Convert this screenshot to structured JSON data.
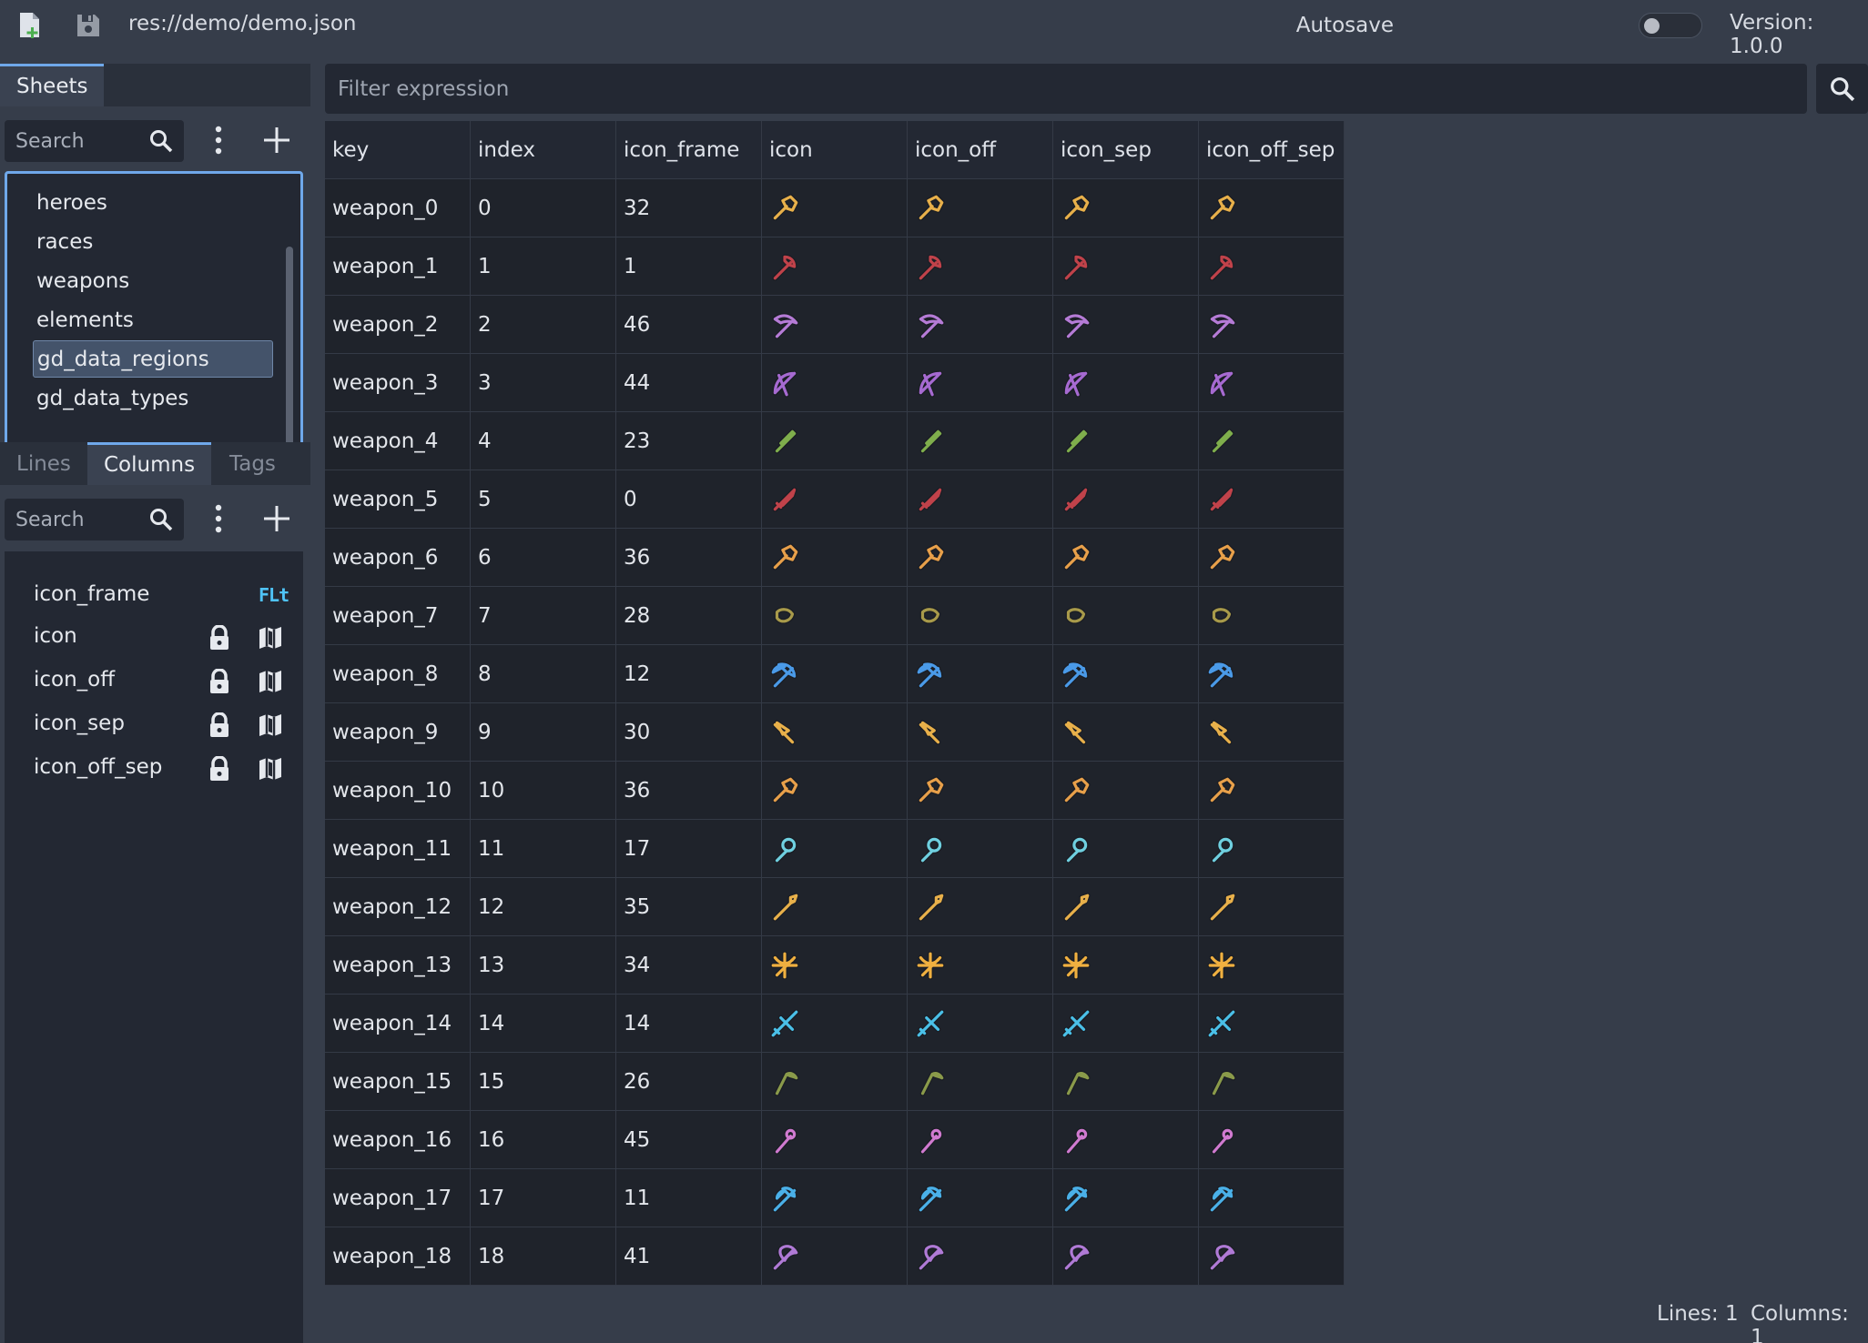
{
  "toolbar": {
    "file_path": "res://demo/demo.json",
    "autosave_label": "Autosave",
    "autosave_on": false,
    "version": "Version: 1.0.0"
  },
  "sheets_panel": {
    "tab_label": "Sheets",
    "search_placeholder": "Search",
    "items": [
      "heroes",
      "races",
      "weapons",
      "elements",
      "gd_data_regions",
      "gd_data_types"
    ],
    "selected": "gd_data_regions"
  },
  "columns_panel": {
    "tabs": [
      "Lines",
      "Columns",
      "Tags"
    ],
    "active_tab": "Columns",
    "search_placeholder": "Search",
    "items": [
      {
        "name": "icon_frame",
        "badge": "FLt"
      },
      {
        "name": "icon",
        "locked": true
      },
      {
        "name": "icon_off",
        "locked": true
      },
      {
        "name": "icon_sep",
        "locked": true
      },
      {
        "name": "icon_off_sep",
        "locked": true
      }
    ]
  },
  "filter": {
    "placeholder": "Filter expression"
  },
  "table": {
    "headers": [
      "key",
      "index",
      "icon_frame",
      "icon",
      "icon_off",
      "icon_sep",
      "icon_off_sep"
    ],
    "rows": [
      {
        "key": "weapon_0",
        "index": "0",
        "icon_frame": "32",
        "icon": "hammer-icon",
        "color": "#e8b04a"
      },
      {
        "key": "weapon_1",
        "index": "1",
        "icon_frame": "1",
        "icon": "axe-icon",
        "color": "#c0424a"
      },
      {
        "key": "weapon_2",
        "index": "2",
        "icon_frame": "46",
        "icon": "pickaxe-icon",
        "color": "#b57bd6"
      },
      {
        "key": "weapon_3",
        "index": "3",
        "icon_frame": "44",
        "icon": "bow-icon",
        "color": "#a66ad1"
      },
      {
        "key": "weapon_4",
        "index": "4",
        "icon_frame": "23",
        "icon": "dagger-icon",
        "color": "#7fae4c"
      },
      {
        "key": "weapon_5",
        "index": "5",
        "icon_frame": "0",
        "icon": "sword-icon",
        "color": "#c0424a"
      },
      {
        "key": "weapon_6",
        "index": "6",
        "icon_frame": "36",
        "icon": "hammer-icon",
        "color": "#e8a04a"
      },
      {
        "key": "weapon_7",
        "index": "7",
        "icon_frame": "28",
        "icon": "sling-icon",
        "color": "#a89a4a"
      },
      {
        "key": "weapon_8",
        "index": "8",
        "icon_frame": "12",
        "icon": "battleaxe-icon",
        "color": "#4a9ae8"
      },
      {
        "key": "weapon_9",
        "index": "9",
        "icon_frame": "30",
        "icon": "knife-icon",
        "color": "#e8b04a"
      },
      {
        "key": "weapon_10",
        "index": "10",
        "icon_frame": "36",
        "icon": "hammer-icon",
        "color": "#e8a04a"
      },
      {
        "key": "weapon_11",
        "index": "11",
        "icon_frame": "17",
        "icon": "mace-icon",
        "color": "#6fd0e0"
      },
      {
        "key": "weapon_12",
        "index": "12",
        "icon_frame": "35",
        "icon": "spear-icon",
        "color": "#e8b04a"
      },
      {
        "key": "weapon_13",
        "index": "13",
        "icon_frame": "34",
        "icon": "crossbow-icon",
        "color": "#f0b040"
      },
      {
        "key": "weapon_14",
        "index": "14",
        "icon_frame": "14",
        "icon": "greatsword-icon",
        "color": "#4ac0e8"
      },
      {
        "key": "weapon_15",
        "index": "15",
        "icon_frame": "26",
        "icon": "scythe-icon",
        "color": "#8a9a4a"
      },
      {
        "key": "weapon_16",
        "index": "16",
        "icon_frame": "45",
        "icon": "staff-icon",
        "color": "#d07ad0"
      },
      {
        "key": "weapon_17",
        "index": "17",
        "icon_frame": "11",
        "icon": "halberd-icon",
        "color": "#4ab0e8"
      },
      {
        "key": "weapon_18",
        "index": "18",
        "icon_frame": "41",
        "icon": "doubleaxe-icon",
        "color": "#b07ad6"
      }
    ]
  },
  "status": {
    "lines": "Lines: 1",
    "columns": "Columns: 1"
  }
}
